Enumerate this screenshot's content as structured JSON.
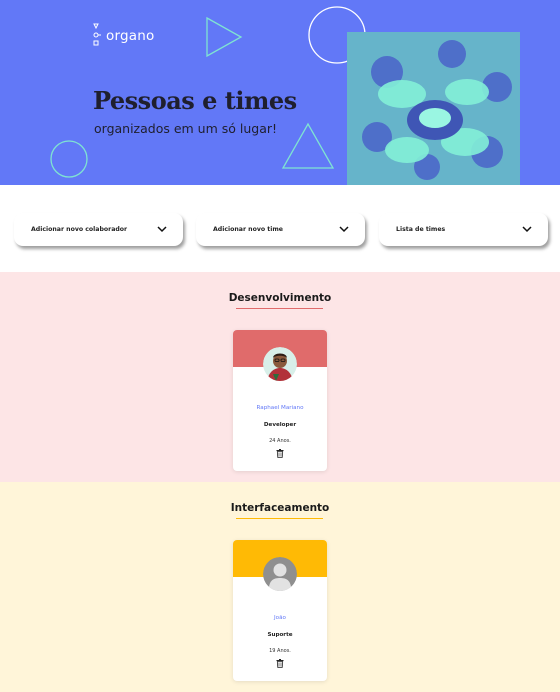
{
  "header": {
    "logo_text": "organo",
    "title": "Pessoas e times",
    "subtitle": "organizados em um só lugar!",
    "brand_color": "#6278f7"
  },
  "menu": [
    {
      "label": "Adicionar novo colaborador",
      "icon": "chevron-down-icon"
    },
    {
      "label": "Adicionar novo time",
      "icon": "chevron-down-icon"
    },
    {
      "label": "Lista de times",
      "icon": "chevron-down-icon"
    }
  ],
  "teams": [
    {
      "name": "Desenvolvimento",
      "background": "#fde5e6",
      "accent": "#e06b6b",
      "members": [
        {
          "name": "Raphael Mariano",
          "role": "Developer",
          "age": "24 Anos.",
          "avatar": "photo-avatar"
        }
      ]
    },
    {
      "name": "Interfaceamento",
      "background": "#fff5d9",
      "accent": "#ffba05",
      "members": [
        {
          "name": "João",
          "role": "Suporte",
          "age": "19 Anos.",
          "avatar": "default-user-avatar"
        }
      ]
    }
  ]
}
